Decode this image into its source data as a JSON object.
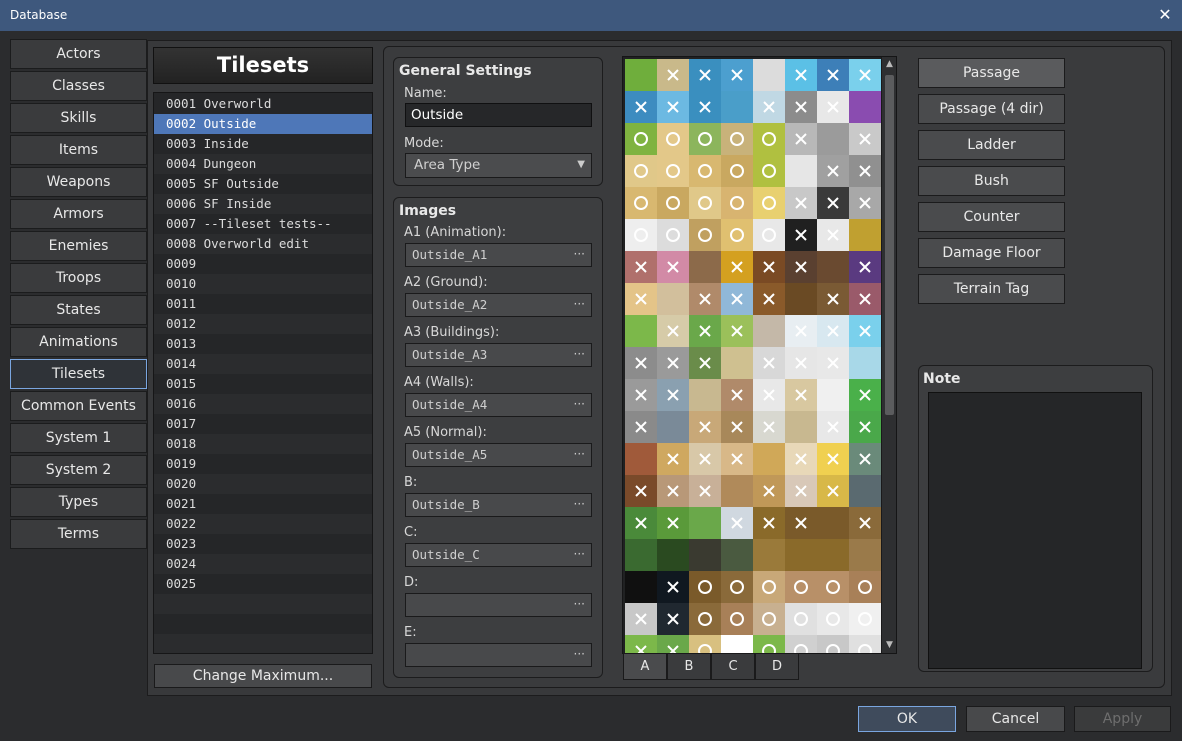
{
  "window": {
    "title": "Database",
    "close_glyph": "✕"
  },
  "categories": [
    "Actors",
    "Classes",
    "Skills",
    "Items",
    "Weapons",
    "Armors",
    "Enemies",
    "Troops",
    "States",
    "Animations",
    "Tilesets",
    "Common Events",
    "System 1",
    "System 2",
    "Types",
    "Terms"
  ],
  "active_category": "Tilesets",
  "tileset_list": {
    "header": "Tilesets",
    "selected_index": 1,
    "rows": [
      "0001 Overworld",
      "0002 Outside",
      "0003 Inside",
      "0004 Dungeon",
      "0005 SF Outside",
      "0006 SF Inside",
      "0007 --Tileset tests--",
      "0008 Overworld edit",
      "0009",
      "0010",
      "0011",
      "0012",
      "0013",
      "0014",
      "0015",
      "0016",
      "0017",
      "0018",
      "0019",
      "0020",
      "0021",
      "0022",
      "0023",
      "0024",
      "0025"
    ],
    "change_max_label": "Change Maximum..."
  },
  "general": {
    "title": "General Settings",
    "name_label": "Name:",
    "name_value": "Outside",
    "mode_label": "Mode:",
    "mode_value": "Area Type"
  },
  "images": {
    "title": "Images",
    "fields": [
      {
        "label": "A1 (Animation):",
        "value": "Outside_A1"
      },
      {
        "label": "A2 (Ground):",
        "value": "Outside_A2"
      },
      {
        "label": "A3 (Buildings):",
        "value": "Outside_A3"
      },
      {
        "label": "A4 (Walls):",
        "value": "Outside_A4"
      },
      {
        "label": "A5 (Normal):",
        "value": "Outside_A5"
      },
      {
        "label": "B:",
        "value": "Outside_B"
      },
      {
        "label": "C:",
        "value": "Outside_C"
      },
      {
        "label": "D:",
        "value": ""
      },
      {
        "label": "E:",
        "value": ""
      }
    ],
    "browse_glyph": "···"
  },
  "palette_tabs": [
    "A",
    "B",
    "C",
    "D"
  ],
  "active_palette_tab": "A",
  "flag_buttons": [
    "Passage",
    "Passage (4 dir)",
    "Ladder",
    "Bush",
    "Counter",
    "Damage Floor",
    "Terrain Tag"
  ],
  "active_flag": "Passage",
  "note": {
    "title": "Note",
    "value": ""
  },
  "footer": {
    "ok": "OK",
    "cancel": "Cancel",
    "apply": "Apply"
  },
  "colors": {
    "accent": "#7aa6e0",
    "selection": "#4e77b8",
    "titlebar": "#3e587d"
  }
}
